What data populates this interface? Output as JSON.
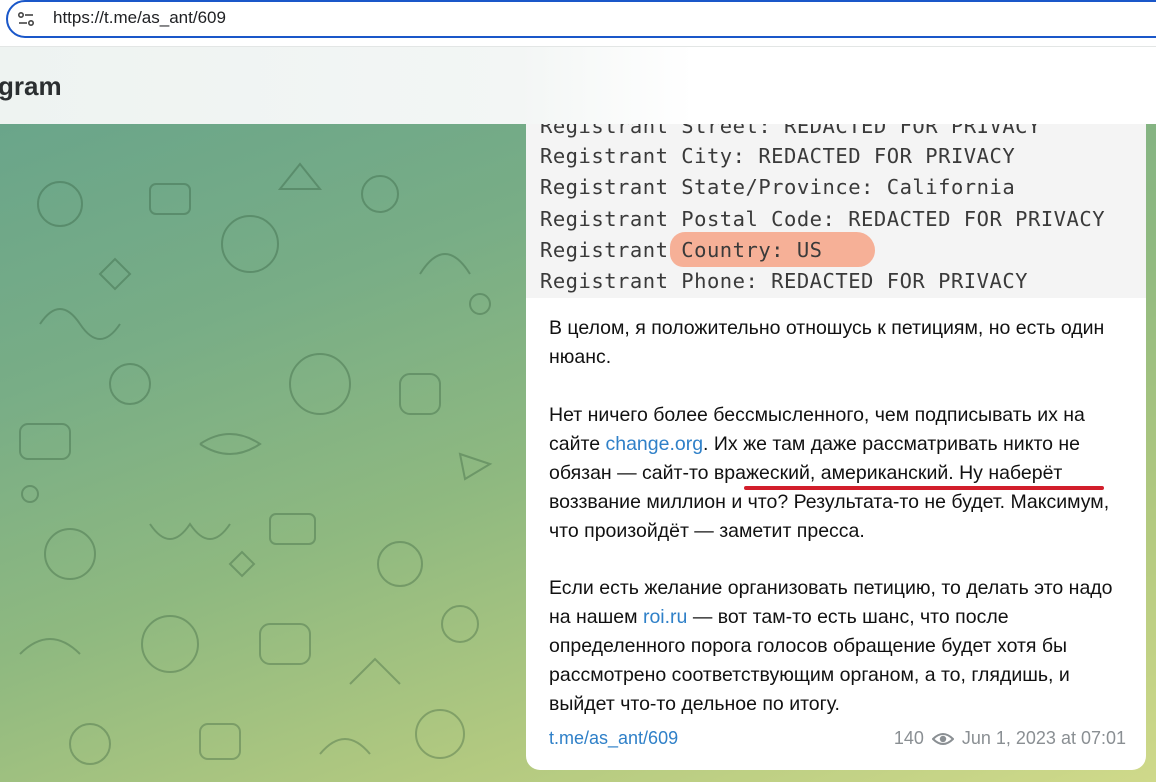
{
  "browser": {
    "url": "https://t.me/as_ant/609"
  },
  "header": {
    "app_title": "gram"
  },
  "post": {
    "whois_lines": [
      "Registrant Street: REDACTED FOR PRIVACY",
      "Registrant City: REDACTED FOR PRIVACY",
      "Registrant State/Province: California",
      "Registrant Postal Code: REDACTED FOR PRIVACY",
      "Registrant Country: US",
      "Registrant Phone: REDACTED FOR PRIVACY"
    ],
    "para1": "В целом, я положительно отношусь к петициям, но есть один нюанс.",
    "para2_a": "Нет ничего более бессмысленного, чем подписывать их на сайте ",
    "para2_link": "change.org",
    "para2_b": ". Их же там даже рассматривать никто не обязан — сайт-то вражеский, американский. Ну наберёт воззвание миллион и что? Результата-то не будет. Максимум, что произойдёт — заметит пресса.",
    "para3_a": "Если есть желание организовать петицию, то делать это надо на нашем ",
    "para3_link": "roi.ru",
    "para3_b": " — вот там-то есть шанс, что после определенного порога голосов обращение будет хотя бы рассмотрено соответствующим органом, а то, глядишь, и выйдет что-то дельное по итогу.",
    "footer_link": "t.me/as_ant/609",
    "views": "140",
    "date": "Jun 1, 2023 at 07:01"
  },
  "colors": {
    "accent_link": "#2f80c8",
    "highlight": "#f79673",
    "underline": "#d21e2b",
    "address_border": "#1a57c9"
  },
  "icons": {
    "site_info": "tune-icon",
    "views": "eye-icon"
  }
}
